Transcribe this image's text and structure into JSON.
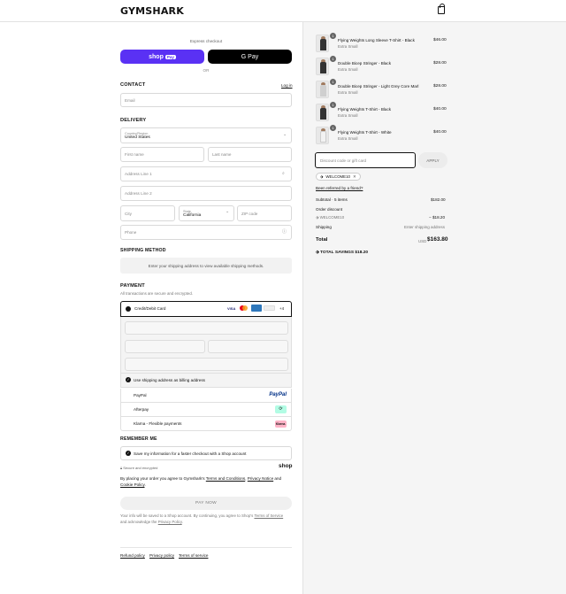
{
  "brand": "GYMSHARK",
  "express": {
    "label": "Express checkout",
    "shop_pay": "shop",
    "shop_pay_tag": "Pay",
    "gpay": "G Pay",
    "or": "OR"
  },
  "contact": {
    "heading": "CONTACT",
    "login": "Log in",
    "email_ph": "Email"
  },
  "delivery": {
    "heading": "DELIVERY",
    "country_label": "Country/Region",
    "country": "United States",
    "first": "First name",
    "last": "Last name",
    "addr1": "Address Line 1",
    "addr2": "Address Line 2",
    "city": "City",
    "state_label": "State",
    "state": "California",
    "zip": "ZIP code",
    "phone": "Phone"
  },
  "shipping_method": {
    "heading": "SHIPPING METHOD",
    "note": "Enter your shipping address to view available shipping methods."
  },
  "payment": {
    "heading": "PAYMENT",
    "sub": "All transactions are secure and encrypted.",
    "card": "Credit/Debit Card",
    "card_more": "+4",
    "billing": "Use shipping address as billing address",
    "paypal": "PayPal",
    "paypal_logo": "PayPal",
    "afterpay": "Afterpay",
    "klarna": "Klarna - Flexible payments",
    "klarna_logo": "Klarna."
  },
  "remember": {
    "heading": "REMEMBER ME",
    "save": "Save my information for a faster checkout with a Shop account",
    "secure": "Secure and encrypted",
    "shop": "shop"
  },
  "terms": {
    "pre": "By placing your order you agree to Gymshark's ",
    "t": "Terms and Conditions",
    "c": ", ",
    "p": "Privacy Notice",
    "and": " and",
    "ck": "Cookie Policy",
    "dot": "."
  },
  "pay_now": "PAY NOW",
  "shop_note": {
    "pre": "Your info will be saved to a Shop account. By continuing, you agree to Shop's ",
    "tos": "Terms of Service",
    "mid": "and acknowledge the ",
    "pp": "Privacy Policy",
    "end": "."
  },
  "footer": {
    "refund": "Refund policy",
    "privacy": "Privacy policy",
    "terms": "Terms of service"
  },
  "items": [
    {
      "name": "Flying Weights Long Sleeve T-Shirt - Black",
      "size": "Extra Small",
      "price": "$46.00",
      "qty": "1",
      "tone": "b"
    },
    {
      "name": "Double Bicep Stringer - Black",
      "size": "Extra Small",
      "price": "$28.00",
      "qty": "1",
      "tone": "b"
    },
    {
      "name": "Double Bicep Stringer - Light Grey Core Marl",
      "size": "Extra Small",
      "price": "$28.00",
      "qty": "1",
      "tone": "g"
    },
    {
      "name": "Flying Weights T-Shirt - Black",
      "size": "Extra Small",
      "price": "$40.00",
      "qty": "1",
      "tone": "b"
    },
    {
      "name": "Flying Weights T-Shirt - White",
      "size": "Extra Small",
      "price": "$40.00",
      "qty": "1",
      "tone": "w"
    }
  ],
  "discount": {
    "placeholder": "Discount code or gift card",
    "apply": "APPLY",
    "tag": "WELCOME10",
    "referred": "Been referred by a friend?"
  },
  "summary": {
    "subtotal_label": "Subtotal · 5 items",
    "subtotal": "$182.00",
    "order_discount": "Order discount",
    "code": "WELCOME10",
    "discount": "− $18.20",
    "shipping_label": "Shipping",
    "shipping": "Enter shipping address",
    "total_label": "Total",
    "currency": "USD",
    "total": "$163.80",
    "savings": "TOTAL SAVINGS  $18.20"
  }
}
